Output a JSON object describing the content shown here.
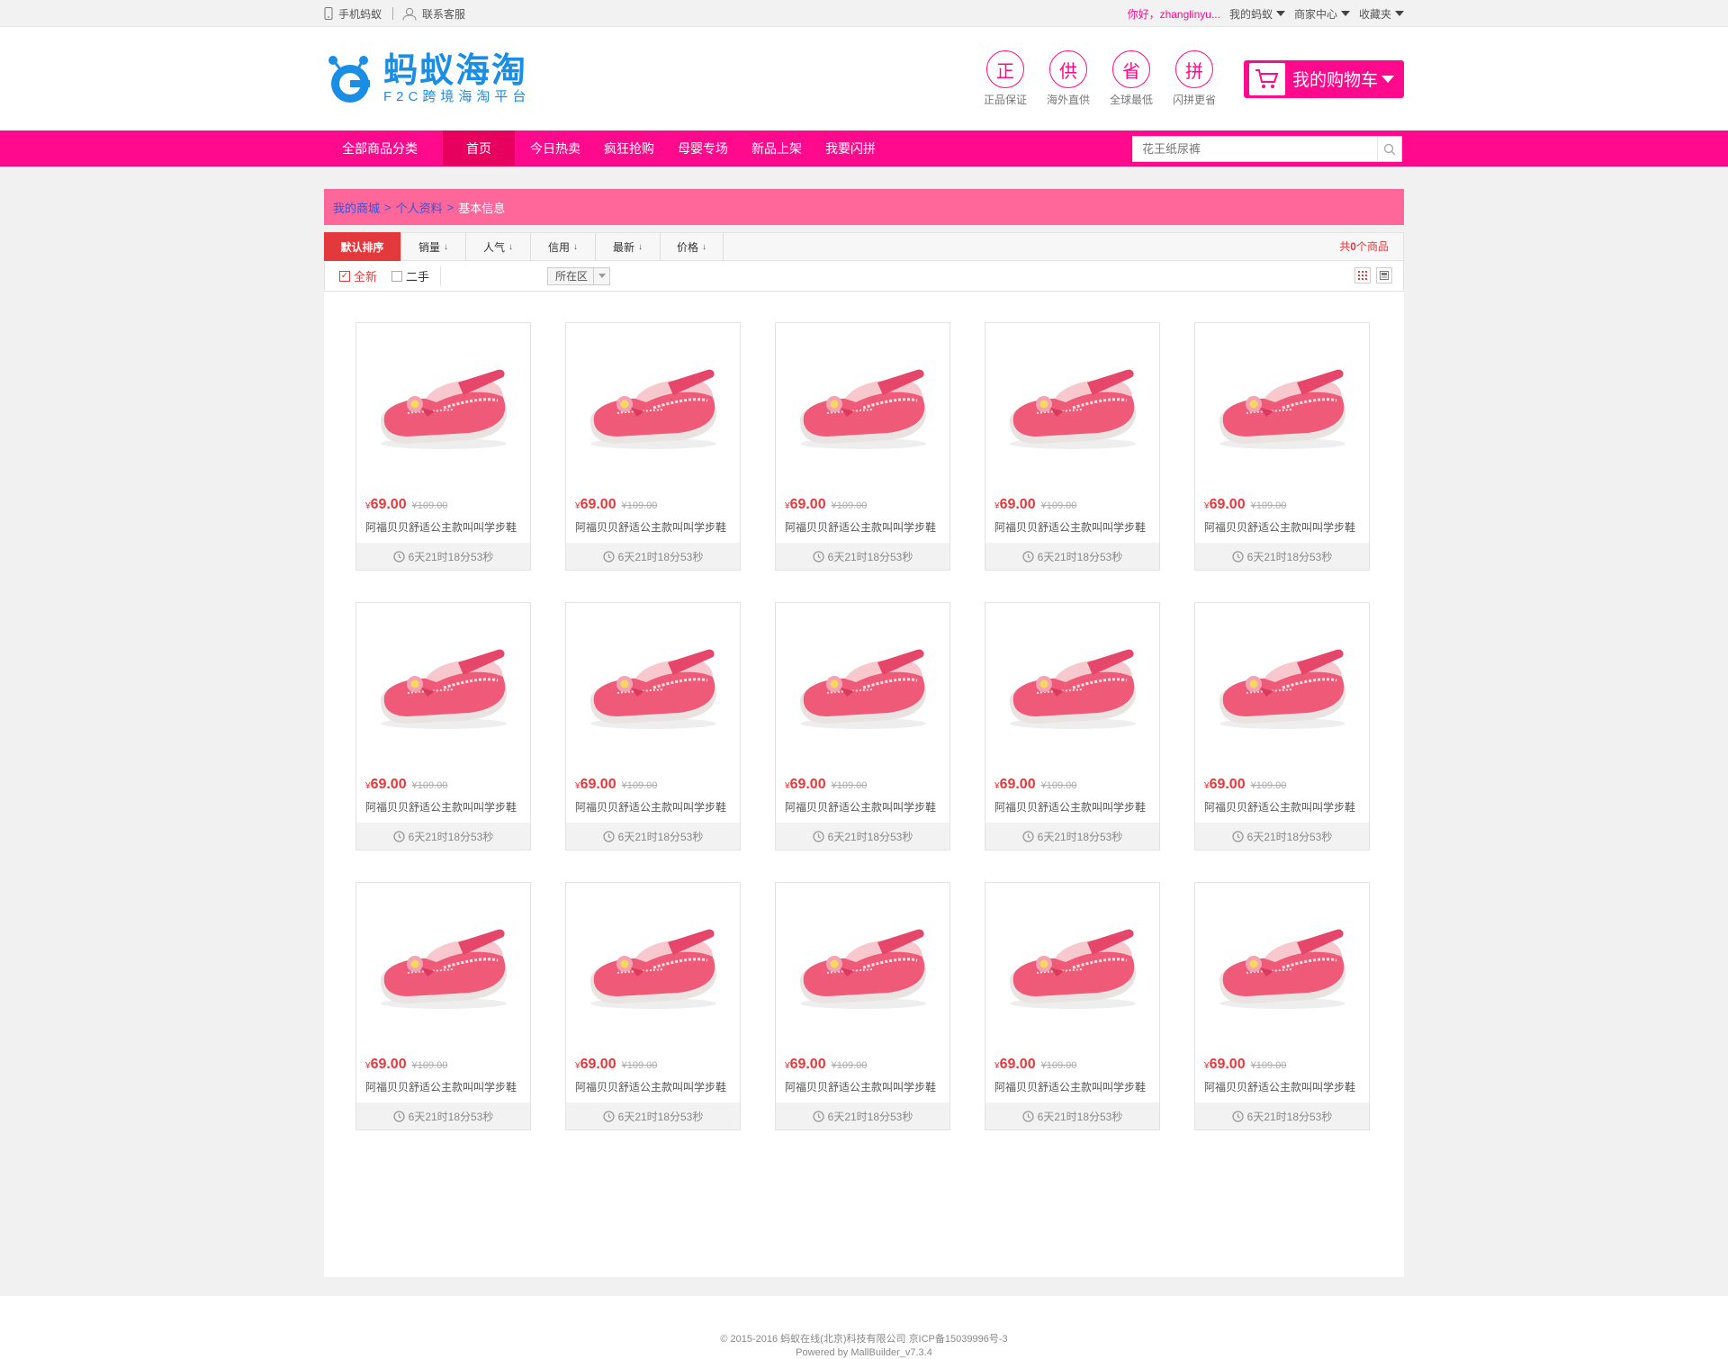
{
  "topbar": {
    "mobile_label": "手机蚂蚁",
    "service_label": "联系客服",
    "greeting": "你好，zhanglinyu...",
    "my_account": "我的蚂蚁",
    "merchant_center": "商家中心",
    "favorites": "收藏夹"
  },
  "header": {
    "logo_title": "蚂蚁海淘",
    "logo_sub": "F2C跨境海淘平台",
    "badges": [
      {
        "icon": "正",
        "label": "正品保证"
      },
      {
        "icon": "供",
        "label": "海外直供"
      },
      {
        "icon": "省",
        "label": "全球最低"
      },
      {
        "icon": "拼",
        "label": "闪拼更省"
      }
    ],
    "cart_label": "我的购物车"
  },
  "nav": {
    "category_label": "全部商品分类",
    "items": [
      "首页",
      "今日热卖",
      "疯狂抢购",
      "母婴专场",
      "新品上架",
      "我要闪拼"
    ],
    "search_placeholder": "花王纸尿裤"
  },
  "breadcrumb": {
    "items": [
      "我的商城",
      "个人资料"
    ],
    "current": "基本信息",
    "separator": ">"
  },
  "sortbar": {
    "active": "默认排序",
    "options": [
      "销量",
      "人气",
      "信用",
      "最新",
      "价格"
    ],
    "total_prefix": "共",
    "total_count": "0",
    "total_suffix": "个商品"
  },
  "filters": {
    "new_label": "全新",
    "used_label": "二手",
    "area_label": "所在区"
  },
  "products": [
    {
      "price_symbol": "¥",
      "price": "69.00",
      "old_price": "¥109.00",
      "title": "阿福贝贝舒适公主款叫叫学步鞋",
      "timer": "6天21时18分53秒"
    },
    {
      "price_symbol": "¥",
      "price": "69.00",
      "old_price": "¥109.00",
      "title": "阿福贝贝舒适公主款叫叫学步鞋",
      "timer": "6天21时18分53秒"
    },
    {
      "price_symbol": "¥",
      "price": "69.00",
      "old_price": "¥109.00",
      "title": "阿福贝贝舒适公主款叫叫学步鞋",
      "timer": "6天21时18分53秒"
    },
    {
      "price_symbol": "¥",
      "price": "69.00",
      "old_price": "¥109.00",
      "title": "阿福贝贝舒适公主款叫叫学步鞋",
      "timer": "6天21时18分53秒"
    },
    {
      "price_symbol": "¥",
      "price": "69.00",
      "old_price": "¥109.00",
      "title": "阿福贝贝舒适公主款叫叫学步鞋",
      "timer": "6天21时18分53秒"
    },
    {
      "price_symbol": "¥",
      "price": "69.00",
      "old_price": "¥109.00",
      "title": "阿福贝贝舒适公主款叫叫学步鞋",
      "timer": "6天21时18分53秒"
    },
    {
      "price_symbol": "¥",
      "price": "69.00",
      "old_price": "¥109.00",
      "title": "阿福贝贝舒适公主款叫叫学步鞋",
      "timer": "6天21时18分53秒"
    },
    {
      "price_symbol": "¥",
      "price": "69.00",
      "old_price": "¥109.00",
      "title": "阿福贝贝舒适公主款叫叫学步鞋",
      "timer": "6天21时18分53秒"
    },
    {
      "price_symbol": "¥",
      "price": "69.00",
      "old_price": "¥109.00",
      "title": "阿福贝贝舒适公主款叫叫学步鞋",
      "timer": "6天21时18分53秒"
    },
    {
      "price_symbol": "¥",
      "price": "69.00",
      "old_price": "¥109.00",
      "title": "阿福贝贝舒适公主款叫叫学步鞋",
      "timer": "6天21时18分53秒"
    },
    {
      "price_symbol": "¥",
      "price": "69.00",
      "old_price": "¥109.00",
      "title": "阿福贝贝舒适公主款叫叫学步鞋",
      "timer": "6天21时18分53秒"
    },
    {
      "price_symbol": "¥",
      "price": "69.00",
      "old_price": "¥109.00",
      "title": "阿福贝贝舒适公主款叫叫学步鞋",
      "timer": "6天21时18分53秒"
    },
    {
      "price_symbol": "¥",
      "price": "69.00",
      "old_price": "¥109.00",
      "title": "阿福贝贝舒适公主款叫叫学步鞋",
      "timer": "6天21时18分53秒"
    },
    {
      "price_symbol": "¥",
      "price": "69.00",
      "old_price": "¥109.00",
      "title": "阿福贝贝舒适公主款叫叫学步鞋",
      "timer": "6天21时18分53秒"
    },
    {
      "price_symbol": "¥",
      "price": "69.00",
      "old_price": "¥109.00",
      "title": "阿福贝贝舒适公主款叫叫学步鞋",
      "timer": "6天21时18分53秒"
    }
  ],
  "footer": {
    "copyright": "© 2015-2016 蚂蚁在线(北京)科技有限公司 京ICP备15039996号-3",
    "powered": "Powered by MallBuilder_v7.3.4"
  },
  "colors": {
    "brand_pink": "#ff0a8c",
    "breadcrumb_bg": "#ff6699",
    "price_red": "#e4393c",
    "logo_blue": "#1a8ee5"
  }
}
